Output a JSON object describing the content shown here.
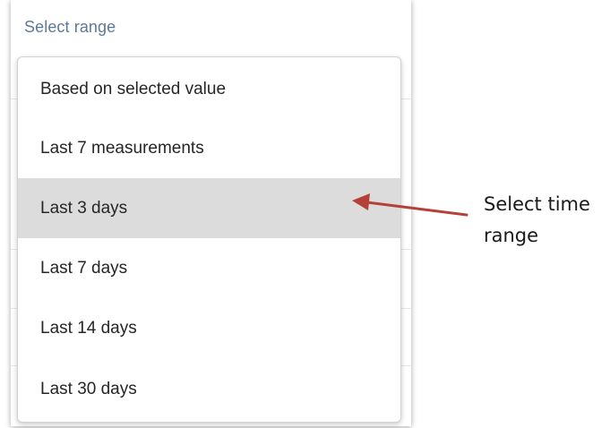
{
  "header": {
    "title": "Select range"
  },
  "menu": {
    "selected_index": 2,
    "items": [
      {
        "label": "Based on selected value"
      },
      {
        "label": "Last 7 measurements"
      },
      {
        "label": "Last 3 days"
      },
      {
        "label": "Last 7 days"
      },
      {
        "label": "Last 14 days"
      },
      {
        "label": "Last 30 days"
      }
    ]
  },
  "annotation": {
    "text": "Select time range",
    "arrow_color": "#b5403a"
  },
  "colors": {
    "selected_bg": "#dcdcdc",
    "title_text": "#5d7a96"
  }
}
